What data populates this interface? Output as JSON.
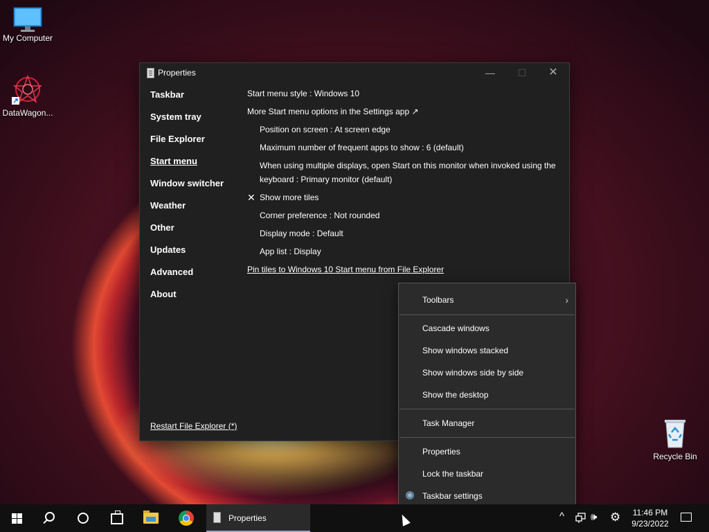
{
  "desktop": {
    "icons": [
      {
        "label": "My Computer"
      },
      {
        "label": "DataWagon..."
      },
      {
        "label": "Recycle Bin"
      }
    ]
  },
  "window": {
    "title": "Properties",
    "controls": {
      "minimize": "—",
      "maximize": "☐",
      "close": "✕"
    },
    "nav": [
      {
        "label": "Taskbar"
      },
      {
        "label": "System tray"
      },
      {
        "label": "File Explorer"
      },
      {
        "label": "Start menu",
        "active": true
      },
      {
        "label": "Window switcher"
      },
      {
        "label": "Weather"
      },
      {
        "label": "Other"
      },
      {
        "label": "Updates"
      },
      {
        "label": "Advanced"
      },
      {
        "label": "About"
      }
    ],
    "restart_link": "Restart File Explorer (*)",
    "content": {
      "start_menu_style": "Start menu style : Windows 10",
      "more_options": "More Start menu options in the Settings app ↗",
      "position": "Position on screen : At screen edge",
      "max_frequent": "Maximum number of frequent apps to show : 6 (default)",
      "multiple_displays": "When using multiple displays, open Start on this monitor when invoked using the keyboard : Primary monitor (default)",
      "show_more_tiles": "Show more tiles",
      "check_mark": "✕",
      "corner_pref": "Corner preference : Not rounded",
      "display_mode": "Display mode : Default",
      "app_list": "App list : Display",
      "pin_tiles": "Pin tiles to Windows 10 Start menu from File Explorer"
    }
  },
  "context_menu": {
    "toolbars": "Toolbars",
    "toolbars_chevron": "›",
    "cascade": "Cascade windows",
    "stacked": "Show windows stacked",
    "side_by_side": "Show windows side by side",
    "show_desktop": "Show the desktop",
    "task_manager": "Task Manager",
    "properties": "Properties",
    "lock": "Lock the taskbar",
    "taskbar_settings": "Taskbar settings"
  },
  "taskbar": {
    "active_app": "Properties",
    "tray": {
      "chevron": "^",
      "volume": "🕪",
      "settings": "⚙"
    },
    "time": "11:46 PM",
    "date": "9/23/2022"
  }
}
